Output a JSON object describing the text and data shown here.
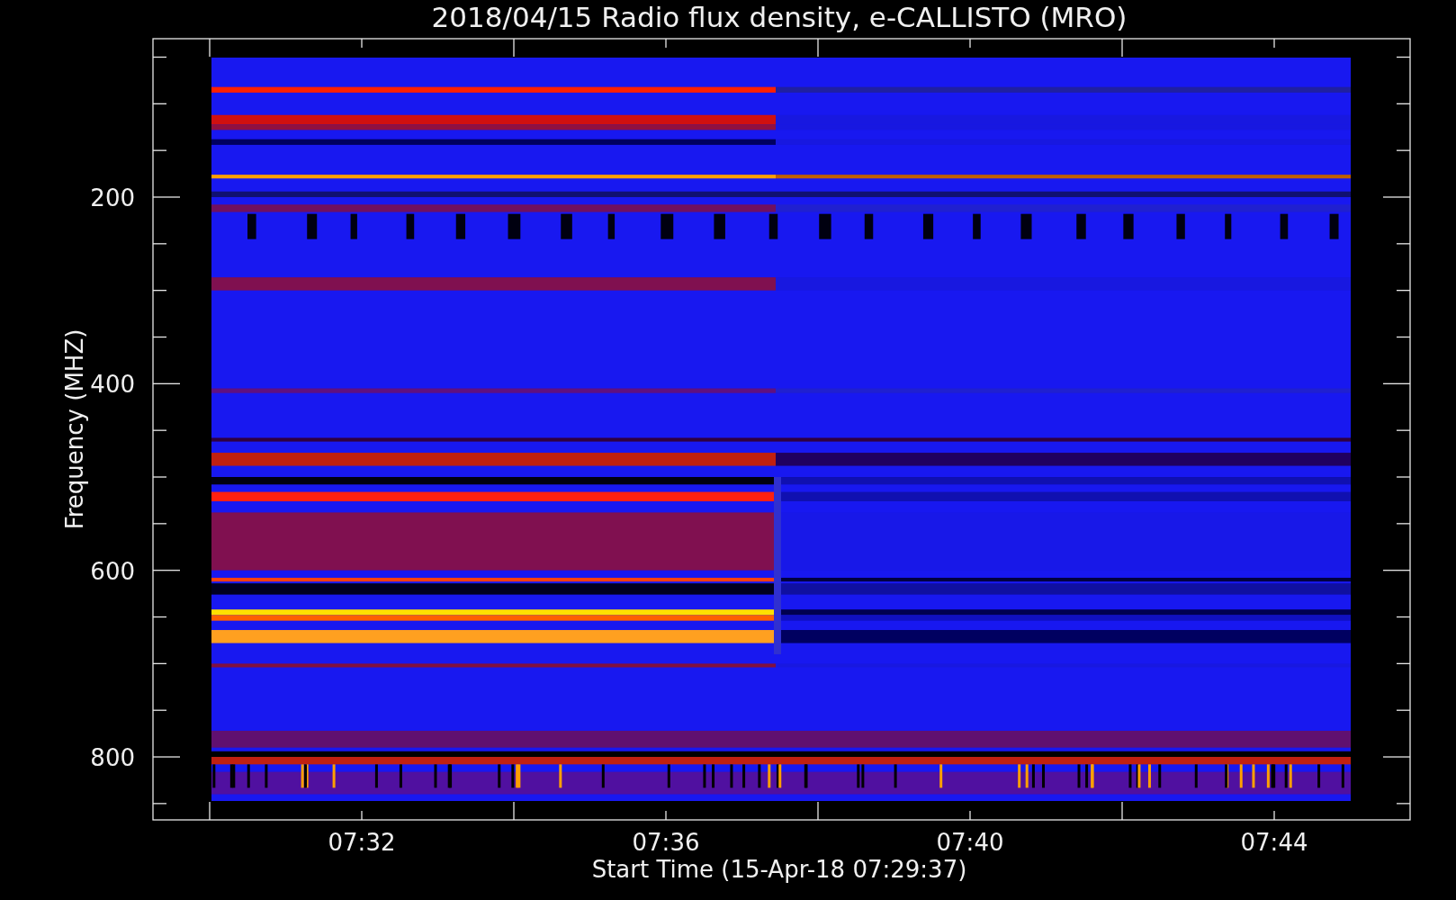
{
  "title": "2018/04/15  Radio flux density, e-CALLISTO (MRO)",
  "y_axis": {
    "label": "Frequency (MHZ)",
    "ticks": [
      "200",
      "400",
      "600",
      "800"
    ]
  },
  "x_axis": {
    "label": "Start Time (15-Apr-18 07:29:37)",
    "ticks": [
      "07:32",
      "07:36",
      "07:40",
      "07:44"
    ]
  }
}
